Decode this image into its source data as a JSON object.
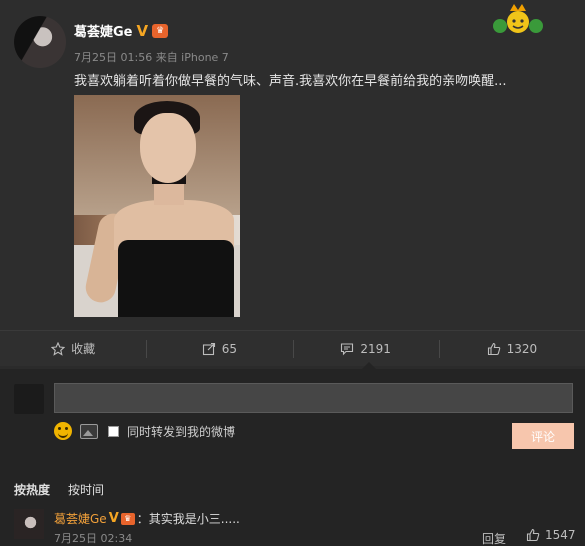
{
  "post": {
    "author": "葛荟婕Ge",
    "verified_mark": "V",
    "meta": "7月25日 01:56 来自 iPhone 7",
    "text": "我喜欢躺着听着你做早餐的气味、声音.我喜欢你在早餐前给我的亲吻唤醒...",
    "icons": [
      "verified-v-icon",
      "vip-member-icon",
      "crown-decoration-icon"
    ]
  },
  "actions": [
    {
      "label": "收藏",
      "icon": "star-icon"
    },
    {
      "label": "65",
      "icon": "repost-icon"
    },
    {
      "label": "2191",
      "icon": "comment-icon"
    },
    {
      "label": "1320",
      "icon": "thumbs-up-icon"
    }
  ],
  "composer": {
    "input_value": "",
    "repost_label": "同时转发到我的微博",
    "submit_label": "评论",
    "submit_color": "#f7c6ad"
  },
  "sort": {
    "hot": "按热度",
    "time": "按时间"
  },
  "comments": [
    {
      "author": "葛荟婕Ge",
      "verified_mark": "V",
      "text": "：其实我是小三.....",
      "time": "7月25日 02:34",
      "reply_label": "回复",
      "likes": "1547"
    }
  ],
  "colors": {
    "background": "#2b2b2b",
    "comment_author": "#f1a03a",
    "verified": "#f5a623"
  }
}
